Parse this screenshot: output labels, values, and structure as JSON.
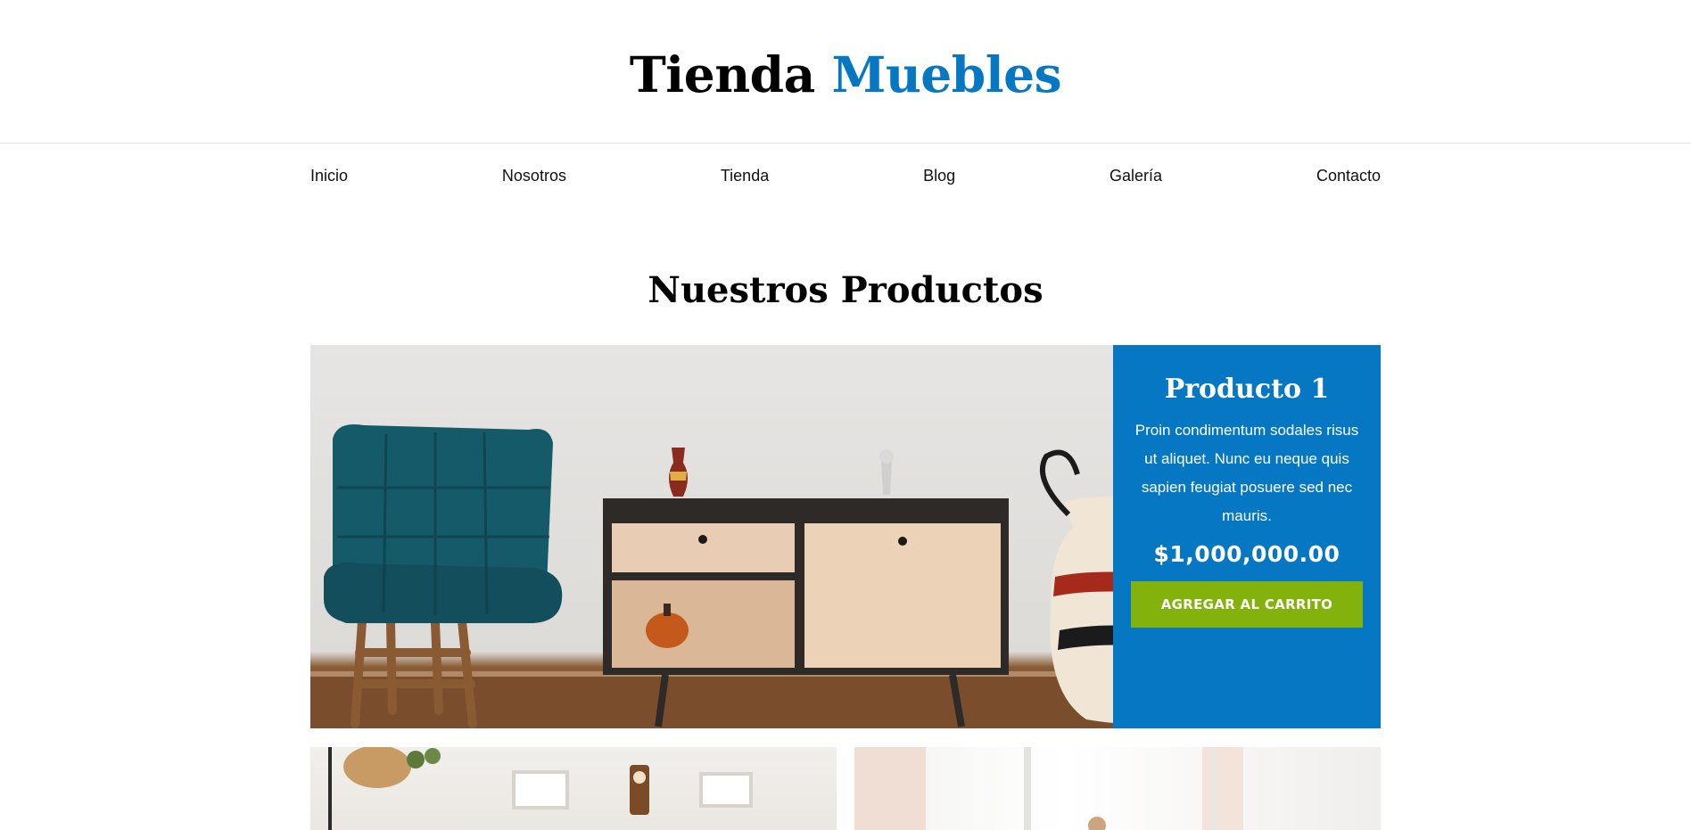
{
  "header": {
    "logo_part1": "Tienda",
    "logo_part2": "Muebles"
  },
  "nav": {
    "items": [
      "Inicio",
      "Nosotros",
      "Tienda",
      "Blog",
      "Galería",
      "Contacto"
    ]
  },
  "products_section": {
    "title": "Nuestros Productos"
  },
  "featured_product": {
    "name": "Producto 1",
    "description": "Proin condimentum sodales risus ut aliquet. Nunc eu neque quis sapien feugiat posuere sed nec mauris.",
    "price": "$1,000,000.00",
    "button_label": "AGREGAR AL CARRITO"
  },
  "colors": {
    "brand_blue": "#0677c2",
    "cart_green": "#83b20c"
  }
}
